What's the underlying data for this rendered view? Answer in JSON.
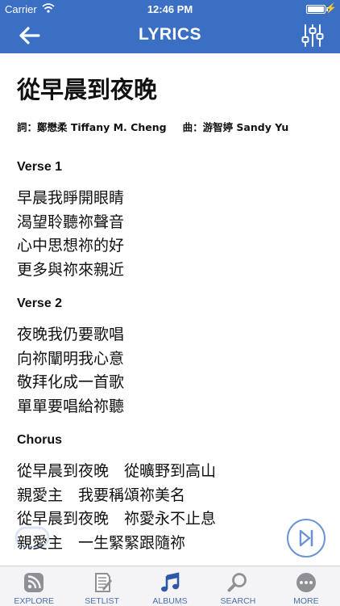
{
  "status_bar": {
    "carrier": "Carrier",
    "time": "12:46 PM"
  },
  "nav": {
    "title": "LYRICS",
    "back_icon": "arrow-left-icon",
    "settings_icon": "sliders-icon"
  },
  "colors": {
    "primary": "#3a6fc4",
    "tab_text": "#4a6fae",
    "active_icon": "#2f57a8",
    "inactive_icon": "#8f9096"
  },
  "song": {
    "title": "從早晨到夜晚",
    "lyricist": "詞：鄭懋柔 Tiffany M. Cheng",
    "composer": "曲：游智婷 Sandy Yu"
  },
  "sections": [
    {
      "label": "Verse 1",
      "lines": [
        "早晨我睜開眼睛",
        "渴望聆聽祢聲音",
        "心中思想祢的好",
        "更多與祢來親近"
      ]
    },
    {
      "label": "Verse 2",
      "lines": [
        "夜晚我仍要歌唱",
        "向祢闡明我心意",
        "敬拜化成一首歌",
        "單單要唱給祢聽"
      ]
    },
    {
      "label": "Chorus",
      "lines": [
        "從早晨到夜晚　從曠野到高山",
        "親愛主　我要稱頌祢美名",
        "從早晨到夜晚　祢愛永不止息",
        "親愛主　一生緊緊跟隨祢"
      ]
    }
  ],
  "tabs": [
    {
      "label": "EXPLORE",
      "icon": "feed-icon",
      "active": false
    },
    {
      "label": "SETLIST",
      "icon": "list-icon",
      "active": false
    },
    {
      "label": "ALBUMS",
      "icon": "music-note-icon",
      "active": true
    },
    {
      "label": "SEARCH",
      "icon": "search-icon",
      "active": false
    },
    {
      "label": "MORE",
      "icon": "more-icon",
      "active": false
    }
  ]
}
